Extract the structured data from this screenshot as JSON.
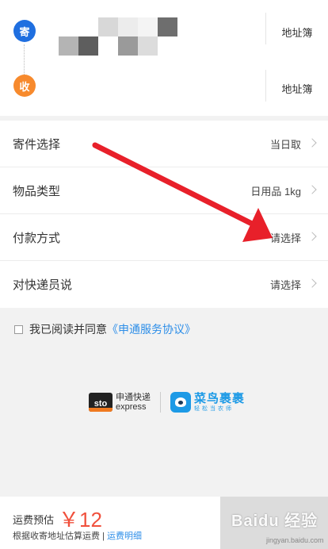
{
  "sender": {
    "badge": "寄",
    "book_label": "地址簿"
  },
  "receiver": {
    "badge": "收",
    "book_label": "地址簿"
  },
  "options": [
    {
      "label": "寄件选择",
      "value": "当日取"
    },
    {
      "label": "物品类型",
      "value": "日用品 1kg"
    },
    {
      "label": "付款方式",
      "value": "请选择"
    },
    {
      "label": "对快递员说",
      "value": "请选择"
    }
  ],
  "agreement": {
    "text": "我已阅读并同意",
    "link": "《申通服务协议》"
  },
  "logos": {
    "sto_mark": "sto",
    "sto_cn": "申通快递",
    "sto_en": "express",
    "cainiao_name": "菜鸟裹裹",
    "cainiao_slogan": "轻松当农师"
  },
  "footer": {
    "fee_label": "运费预估",
    "fee_price": "￥12",
    "fee_note": "根据收寄地址估算运费",
    "fee_divider": "|",
    "fee_link": "运费明细"
  },
  "watermark": {
    "main": "Baidu 经验",
    "sub": "jingyan.baidu.com"
  },
  "colors": {
    "sender_badge": "#1f6fe0",
    "receiver_badge": "#f78a2d",
    "price": "#f0503c",
    "link": "#2d8ee8",
    "annotation_arrow": "#e8202a"
  },
  "mosaic": {
    "sender": [
      "#ffffff",
      "#ffffff",
      "#d8d8d8",
      "#ececec",
      "#f4f4f4",
      "#6e6e6e",
      "#b4b4b4",
      "#5e5e5e",
      "#ffffff",
      "#9a9a9a",
      "#dcdcdc",
      "#ffffff"
    ],
    "receiver": [
      "#d6d6d6",
      "#7e7e7e",
      "#c8c8c8",
      "#d0d0d0"
    ]
  }
}
